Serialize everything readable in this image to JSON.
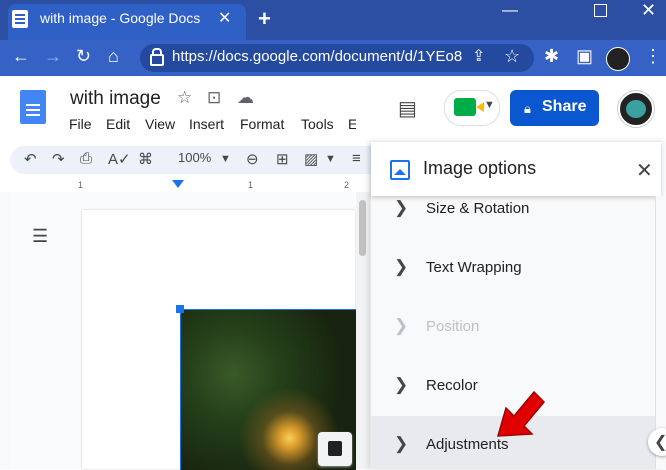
{
  "browser": {
    "tab_title": "with image - Google Docs",
    "tab_close": "✕",
    "new_tab": "+",
    "url": "https://docs.google.com/document/d/1YEo8...",
    "win_min": "—",
    "win_close": "✕"
  },
  "docs": {
    "title": "with image",
    "menus": [
      "File",
      "Edit",
      "View",
      "Insert",
      "Format",
      "Tools",
      "E"
    ],
    "zoom": "100%",
    "share_label": "Share"
  },
  "ruler": {
    "marks": [
      "1",
      "1",
      "2"
    ]
  },
  "panel": {
    "title": "Image options",
    "close": "✕",
    "options": [
      {
        "label": "Size & Rotation",
        "disabled": false
      },
      {
        "label": "Text Wrapping",
        "disabled": false
      },
      {
        "label": "Position",
        "disabled": true
      },
      {
        "label": "Recolor",
        "disabled": false
      },
      {
        "label": "Adjustments",
        "disabled": false
      }
    ]
  },
  "colors": {
    "accent": "#0b57d0",
    "arrow": "#e00000",
    "disabled": "#bdc1c6"
  }
}
